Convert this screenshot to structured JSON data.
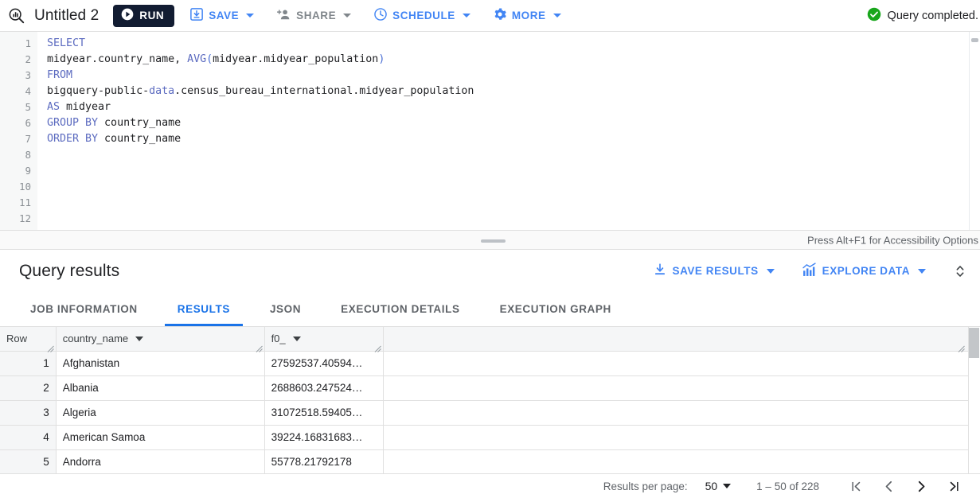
{
  "toolbar": {
    "logo_icon": "query-magnifier-icon",
    "title": "Untitled 2",
    "run_label": "RUN",
    "save_label": "SAVE",
    "share_label": "SHARE",
    "schedule_label": "SCHEDULE",
    "more_label": "MORE",
    "status_text": "Query completed.",
    "accent_blue": "#4285f4",
    "disabled_gray": "#80868b",
    "run_bg": "#121c32",
    "status_green": "#18a61c"
  },
  "editor": {
    "line_numbers": [
      "1",
      "2",
      "3",
      "4",
      "5",
      "6",
      "7",
      "8",
      "9",
      "10",
      "11",
      "12"
    ],
    "lines": [
      {
        "tokens": [
          {
            "t": "SELECT",
            "c": "kw"
          }
        ]
      },
      {
        "tokens": [
          {
            "t": "midyear.country_name, ",
            "c": "plain"
          },
          {
            "t": "AVG",
            "c": "fn"
          },
          {
            "t": "(",
            "c": "paren"
          },
          {
            "t": "midyear.midyear_population",
            "c": "plain"
          },
          {
            "t": ")",
            "c": "paren"
          }
        ]
      },
      {
        "tokens": [
          {
            "t": "FROM",
            "c": "kw"
          }
        ]
      },
      {
        "tokens": [
          {
            "t": "bigquery-public-",
            "c": "plain"
          },
          {
            "t": "data",
            "c": "kw"
          },
          {
            "t": ".census_bureau_international.midyear_population",
            "c": "plain"
          }
        ]
      },
      {
        "tokens": [
          {
            "t": "AS",
            "c": "kw"
          },
          {
            "t": " midyear",
            "c": "plain"
          }
        ]
      },
      {
        "tokens": [
          {
            "t": "GROUP BY",
            "c": "kw"
          },
          {
            "t": " country_name",
            "c": "plain"
          }
        ]
      },
      {
        "tokens": [
          {
            "t": "ORDER BY",
            "c": "kw"
          },
          {
            "t": " country_name",
            "c": "plain"
          }
        ]
      },
      {
        "tokens": []
      },
      {
        "tokens": []
      },
      {
        "tokens": []
      },
      {
        "tokens": []
      },
      {
        "tokens": []
      }
    ]
  },
  "splitter": {
    "a11y_hint": "Press Alt+F1 for Accessibility Options"
  },
  "results_header": {
    "title": "Query results",
    "save_results_label": "SAVE RESULTS",
    "explore_data_label": "EXPLORE DATA"
  },
  "tabs": [
    {
      "label": "JOB INFORMATION",
      "active": false
    },
    {
      "label": "RESULTS",
      "active": true
    },
    {
      "label": "JSON",
      "active": false
    },
    {
      "label": "EXECUTION DETAILS",
      "active": false
    },
    {
      "label": "EXECUTION GRAPH",
      "active": false
    }
  ],
  "table": {
    "columns": [
      "Row",
      "country_name",
      "f0_",
      ""
    ],
    "rows": [
      {
        "row": "1",
        "country_name": "Afghanistan",
        "f0_": "27592537.40594…"
      },
      {
        "row": "2",
        "country_name": "Albania",
        "f0_": "2688603.247524…"
      },
      {
        "row": "3",
        "country_name": "Algeria",
        "f0_": "31072518.59405…"
      },
      {
        "row": "4",
        "country_name": "American Samoa",
        "f0_": "39224.16831683…"
      },
      {
        "row": "5",
        "country_name": "Andorra",
        "f0_": "55778.21792178"
      }
    ]
  },
  "pagination": {
    "per_page_label": "Results per page:",
    "per_page_value": "50",
    "range_text": "1 – 50 of 228",
    "first_icon": "first-page-icon",
    "prev_icon": "previous-page-icon",
    "next_icon": "next-page-icon",
    "last_icon": "last-page-icon"
  }
}
